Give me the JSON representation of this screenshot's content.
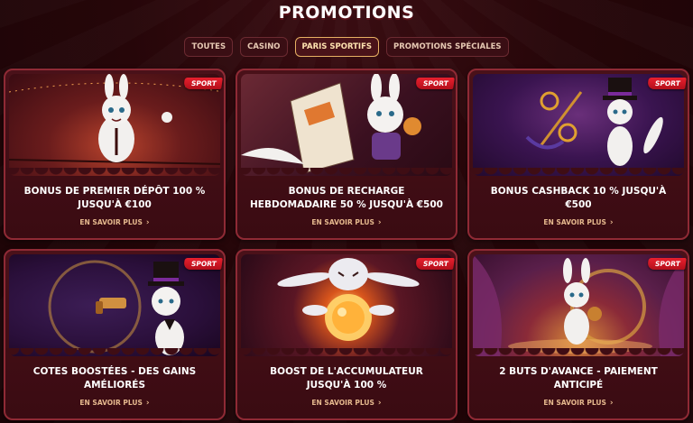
{
  "page": {
    "title": "PROMOTIONS"
  },
  "filters": [
    {
      "label": "TOUTES",
      "active": false
    },
    {
      "label": "CASINO",
      "active": false
    },
    {
      "label": "PARIS SPORTIFS",
      "active": true
    },
    {
      "label": "PROMOTIONS SPÉCIALES",
      "active": false
    }
  ],
  "cards": [
    {
      "badge": "SPORT",
      "title": "BONUS DE PREMIER DÉPÔT 100 % JUSQU'À €100",
      "cta": "EN SAVOIR PLUS"
    },
    {
      "badge": "SPORT",
      "title": "BONUS DE RECHARGE HEBDOMADAIRE 50 % JUSQU'À €500",
      "cta": "EN SAVOIR PLUS"
    },
    {
      "badge": "SPORT",
      "title": "BONUS CASHBACK 10 % JUSQU'À €500",
      "cta": "EN SAVOIR PLUS"
    },
    {
      "badge": "SPORT",
      "title": "COTES BOOSTÉES - DES GAINS AMÉLIORÉS",
      "cta": "EN SAVOIR PLUS"
    },
    {
      "badge": "SPORT",
      "title": "BOOST DE L'ACCUMULATEUR JUSQU'À 100 %",
      "cta": "EN SAVOIR PLUS"
    },
    {
      "badge": "SPORT",
      "title": "2 BUTS D'AVANCE - PAIEMENT ANTICIPÉ",
      "cta": "EN SAVOIR PLUS"
    }
  ],
  "icons": {
    "chevron": "chevron-right-icon"
  },
  "colors": {
    "accent": "#e7b063",
    "badge": "#d8192a",
    "cta": "#e6b98e",
    "card_border": "#8f2a35"
  }
}
